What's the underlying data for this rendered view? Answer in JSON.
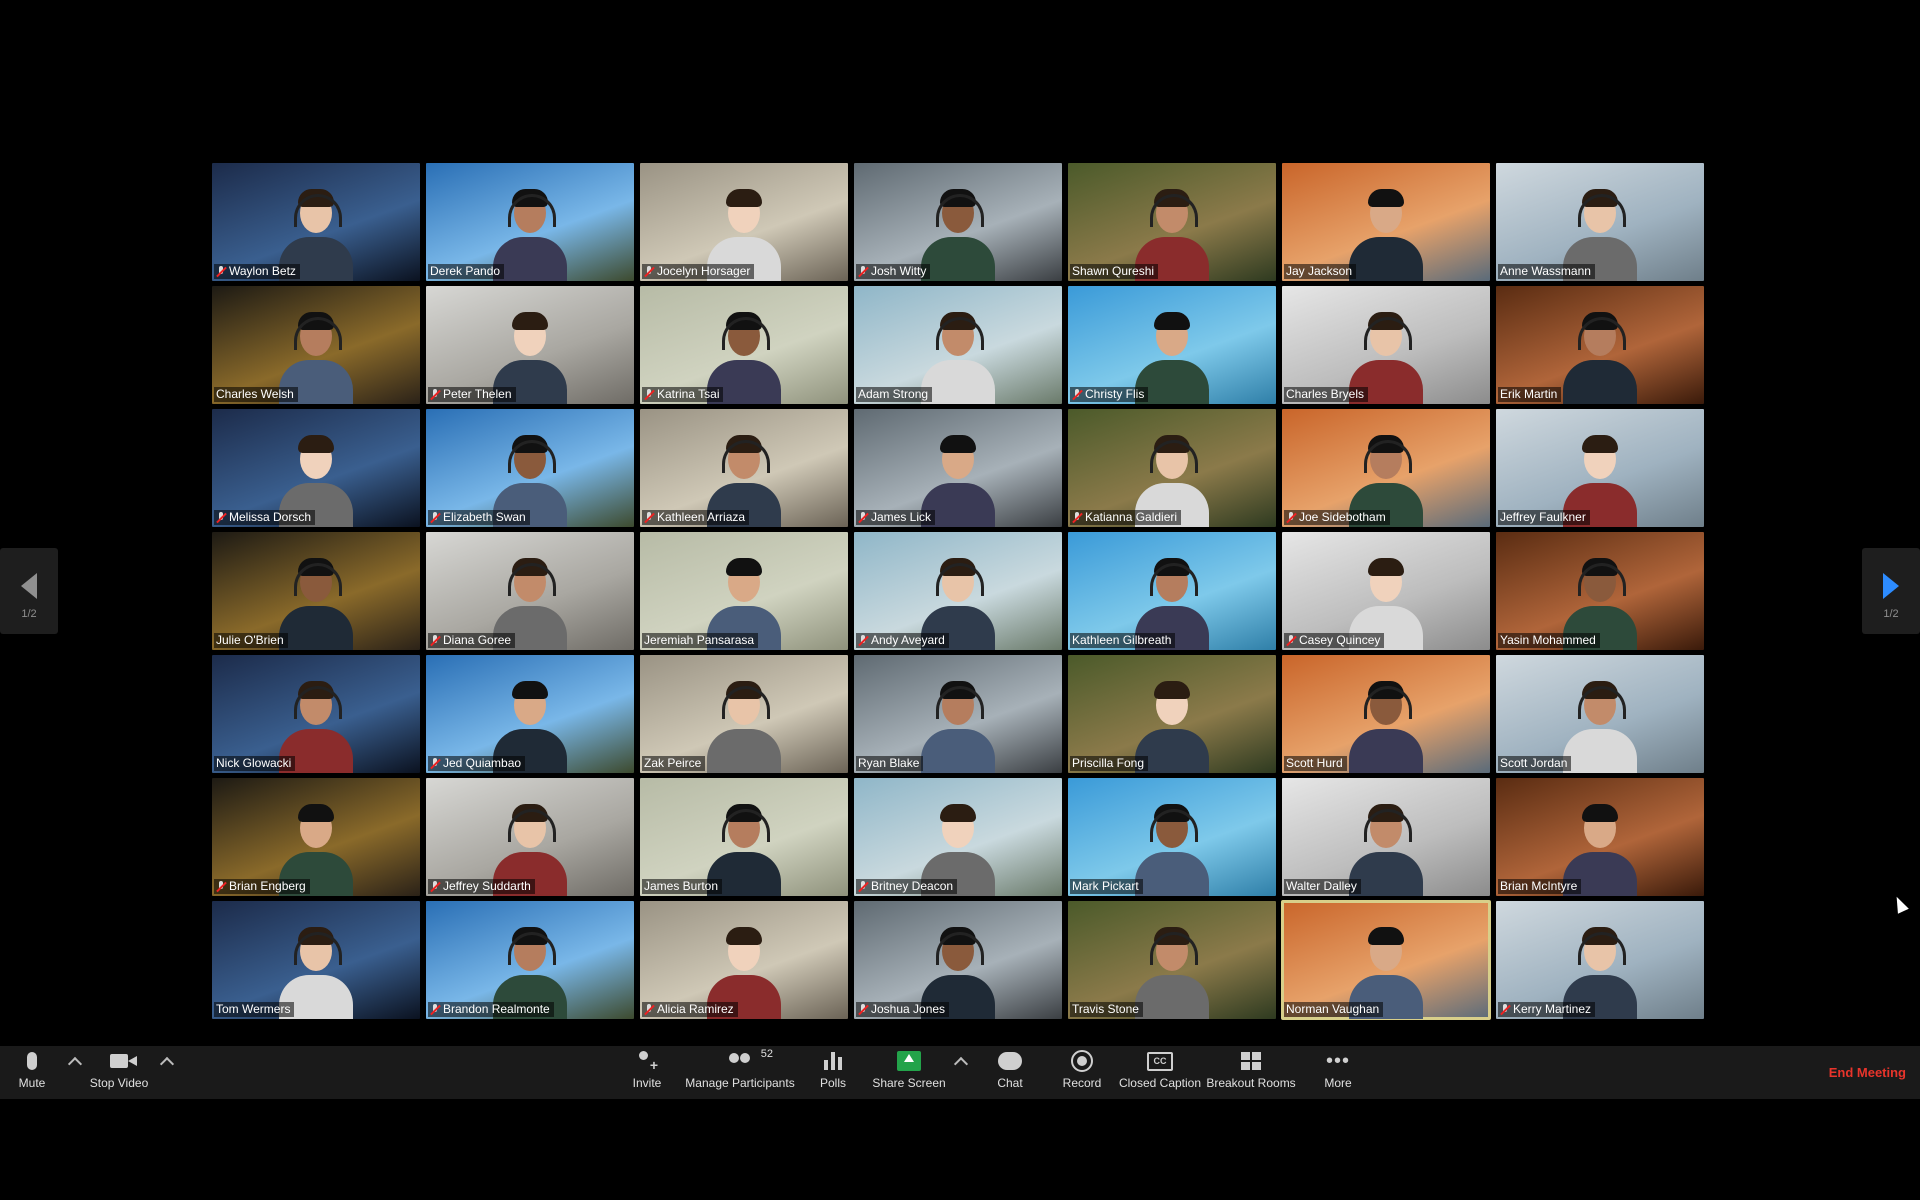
{
  "gallery": {
    "participants": [
      {
        "name": "Waylon Betz",
        "muted": true
      },
      {
        "name": "Derek Pando",
        "muted": false
      },
      {
        "name": "Jocelyn Horsager",
        "muted": true
      },
      {
        "name": "Josh Witty",
        "muted": true
      },
      {
        "name": "Shawn Qureshi",
        "muted": false
      },
      {
        "name": "Jay Jackson",
        "muted": false
      },
      {
        "name": "Anne Wassmann",
        "muted": false
      },
      {
        "name": "Charles Welsh",
        "muted": false
      },
      {
        "name": "Peter Thelen",
        "muted": true
      },
      {
        "name": "Katrina Tsai",
        "muted": true
      },
      {
        "name": "Adam Strong",
        "muted": false
      },
      {
        "name": "Christy Flis",
        "muted": true
      },
      {
        "name": "Charles Bryels",
        "muted": false
      },
      {
        "name": "Erik Martin",
        "muted": false
      },
      {
        "name": "Melissa Dorsch",
        "muted": true
      },
      {
        "name": "Elizabeth Swan",
        "muted": true
      },
      {
        "name": "Kathleen Arriaza",
        "muted": true
      },
      {
        "name": "James Lick",
        "muted": true
      },
      {
        "name": "Katianna Galdieri",
        "muted": true
      },
      {
        "name": "Joe Sidebotham",
        "muted": true
      },
      {
        "name": "Jeffrey Faulkner",
        "muted": false
      },
      {
        "name": "Julie O'Brien",
        "muted": false
      },
      {
        "name": "Diana Goree",
        "muted": true
      },
      {
        "name": "Jeremiah Pansarasa",
        "muted": false
      },
      {
        "name": "Andy Aveyard",
        "muted": true
      },
      {
        "name": "Kathleen Gilbreath",
        "muted": false
      },
      {
        "name": "Casey Quincey",
        "muted": true
      },
      {
        "name": "Yasin Mohammed",
        "muted": false
      },
      {
        "name": "Nick Glowacki",
        "muted": false
      },
      {
        "name": "Jed Quiambao",
        "muted": true
      },
      {
        "name": "Zak Peirce",
        "muted": false
      },
      {
        "name": "Ryan Blake",
        "muted": false
      },
      {
        "name": "Priscilla Fong",
        "muted": false
      },
      {
        "name": "Scott Hurd",
        "muted": false
      },
      {
        "name": "Scott Jordan",
        "muted": false
      },
      {
        "name": "Brian Engberg",
        "muted": true
      },
      {
        "name": "Jeffrey Suddarth",
        "muted": true
      },
      {
        "name": "James Burton",
        "muted": false
      },
      {
        "name": "Britney Deacon",
        "muted": true
      },
      {
        "name": "Mark Pickart",
        "muted": false
      },
      {
        "name": "Walter Dalley",
        "muted": false
      },
      {
        "name": "Brian McIntyre",
        "muted": false
      },
      {
        "name": "Tom Wermers",
        "muted": false
      },
      {
        "name": "Brandon Realmonte",
        "muted": true
      },
      {
        "name": "Alicia Ramirez",
        "muted": true
      },
      {
        "name": "Joshua Jones",
        "muted": true
      },
      {
        "name": "Travis Stone",
        "muted": false
      },
      {
        "name": "Norman Vaughan",
        "muted": false,
        "active_speaker": true
      },
      {
        "name": "Kerry Martinez",
        "muted": true
      }
    ],
    "page_left": "1/2",
    "page_right": "1/2"
  },
  "toolbar": {
    "mute": "Mute",
    "stop_video": "Stop Video",
    "invite": "Invite",
    "manage_participants": "Manage Participants",
    "participant_count": "52",
    "polls": "Polls",
    "share_screen": "Share Screen",
    "chat": "Chat",
    "record": "Record",
    "closed_caption": "Closed Caption",
    "breakout_rooms": "Breakout Rooms",
    "more": "More",
    "end_meeting": "End Meeting"
  },
  "colors": {
    "end_meeting": "#e8342b",
    "share_screen": "#23a34a",
    "next_page_arrow": "#2d8cff",
    "active_speaker_border": "#d8cf8a"
  }
}
